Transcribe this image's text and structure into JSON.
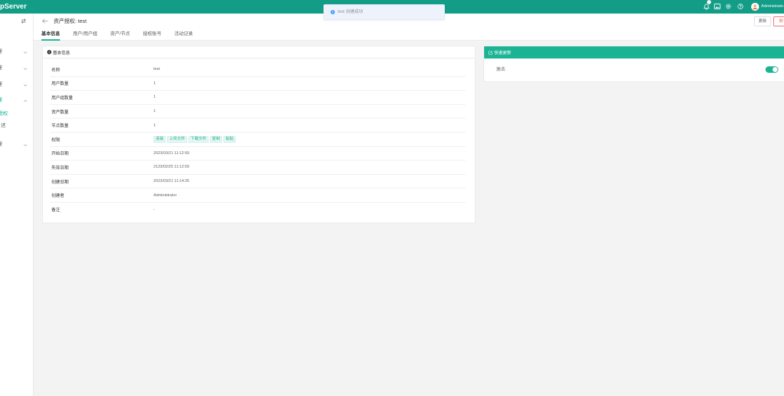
{
  "colors": {
    "topbar": "#139d87",
    "accent": "#1ab394",
    "info": "#409eff",
    "danger": "#f56c6c"
  },
  "topbar": {
    "logo": "pServer",
    "user": "Administrato",
    "icons": [
      "bell-icon",
      "image-icon",
      "gear-icon",
      "question-icon",
      "avatar"
    ]
  },
  "toast": {
    "icon": "info-icon",
    "text": "test 创建成功"
  },
  "sidebar": {
    "toggle_icon": "swap-icon",
    "groups": [
      {
        "label": "理"
      },
      {
        "label": "理"
      },
      {
        "label": "理"
      },
      {
        "label": "理",
        "active": true,
        "expanded": true
      },
      {
        "label": "理"
      }
    ],
    "children": [
      {
        "label": "授权",
        "active": true
      },
      {
        "label": "述"
      }
    ]
  },
  "header": {
    "title": "资产授权: test",
    "update_label": "更新",
    "delete_label": "删"
  },
  "tabs": [
    {
      "label": "基本信息",
      "active": true
    },
    {
      "label": "用户/用户组"
    },
    {
      "label": "资产/节点"
    },
    {
      "label": "授权账号"
    },
    {
      "label": "活动记录"
    }
  ],
  "basic_info": {
    "title": "基本信息",
    "rows": [
      {
        "label": "名称",
        "value": "test"
      },
      {
        "label": "用户数量",
        "value": "1"
      },
      {
        "label": "用户组数量",
        "value": "1"
      },
      {
        "label": "资产数量",
        "value": "1"
      },
      {
        "label": "节点数量",
        "value": "1"
      },
      {
        "label": "权限",
        "tags": [
          "连接",
          "上传文件",
          "下载文件",
          "复制",
          "粘贴"
        ]
      },
      {
        "label": "开始日期",
        "value": "2023/03/21 11:12:59"
      },
      {
        "label": "失效日期",
        "value": "2123/02/25 11:12:59"
      },
      {
        "label": "创建日期",
        "value": "2023/03/21 11:14:25"
      },
      {
        "label": "创建者",
        "value": "Administrator"
      },
      {
        "label": "备注",
        "value": "-"
      }
    ]
  },
  "quick_update": {
    "title": "快速更新",
    "active_label": "激活:",
    "active": true
  }
}
